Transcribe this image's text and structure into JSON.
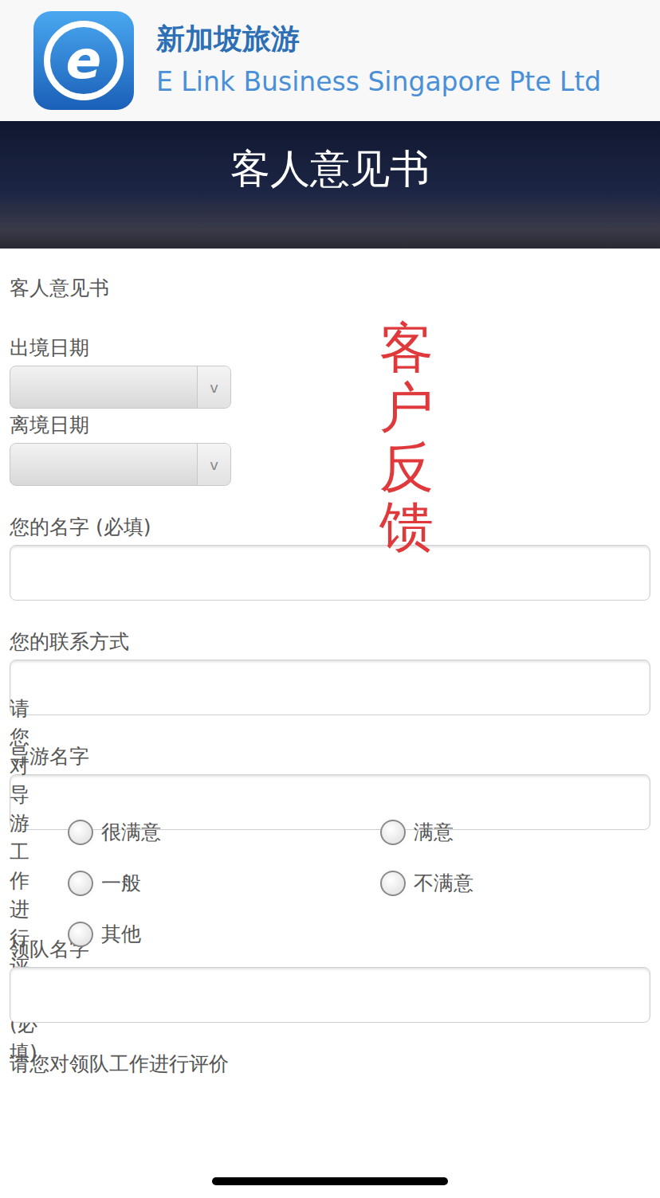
{
  "header": {
    "logo_letter": "e",
    "title": "新加坡旅游",
    "subtitle": "E Link Business Singapore Pte Ltd"
  },
  "banner": {
    "title": "客人意见书"
  },
  "watermark": "客户反馈",
  "form": {
    "items": [
      {
        "kind": "heading",
        "label": "客人意见书"
      },
      {
        "kind": "select",
        "label": "出境日期",
        "arrow": "v"
      },
      {
        "kind": "select",
        "label": "离境日期",
        "arrow": "v"
      },
      {
        "kind": "text",
        "label": "您的名字 (必填)",
        "value": ""
      },
      {
        "kind": "text",
        "label": "您的联系方式",
        "value": ""
      },
      {
        "kind": "text",
        "label": "导游名字",
        "value": ""
      },
      {
        "kind": "radio",
        "label": "请您对导游工作进行评价 (必填)",
        "options": [
          {
            "label": "很满意",
            "selected": false
          },
          {
            "label": "满意",
            "selected": false
          },
          {
            "label": "一般",
            "selected": false
          },
          {
            "label": "不满意",
            "selected": false
          },
          {
            "label": "其他",
            "selected": false
          }
        ]
      },
      {
        "kind": "text",
        "label": "领队名字",
        "value": ""
      },
      {
        "kind": "heading",
        "label": "请您对领队工作进行评价"
      }
    ]
  }
}
